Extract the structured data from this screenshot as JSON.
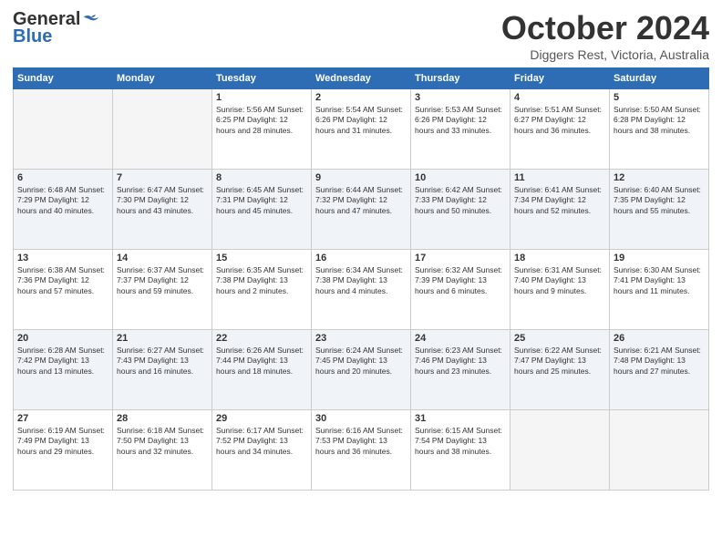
{
  "logo": {
    "general": "General",
    "blue": "Blue"
  },
  "title": "October 2024",
  "subtitle": "Diggers Rest, Victoria, Australia",
  "days_of_week": [
    "Sunday",
    "Monday",
    "Tuesday",
    "Wednesday",
    "Thursday",
    "Friday",
    "Saturday"
  ],
  "weeks": [
    [
      {
        "day": "",
        "info": ""
      },
      {
        "day": "",
        "info": ""
      },
      {
        "day": "1",
        "info": "Sunrise: 5:56 AM\nSunset: 6:25 PM\nDaylight: 12 hours and 28 minutes."
      },
      {
        "day": "2",
        "info": "Sunrise: 5:54 AM\nSunset: 6:26 PM\nDaylight: 12 hours and 31 minutes."
      },
      {
        "day": "3",
        "info": "Sunrise: 5:53 AM\nSunset: 6:26 PM\nDaylight: 12 hours and 33 minutes."
      },
      {
        "day": "4",
        "info": "Sunrise: 5:51 AM\nSunset: 6:27 PM\nDaylight: 12 hours and 36 minutes."
      },
      {
        "day": "5",
        "info": "Sunrise: 5:50 AM\nSunset: 6:28 PM\nDaylight: 12 hours and 38 minutes."
      }
    ],
    [
      {
        "day": "6",
        "info": "Sunrise: 6:48 AM\nSunset: 7:29 PM\nDaylight: 12 hours and 40 minutes."
      },
      {
        "day": "7",
        "info": "Sunrise: 6:47 AM\nSunset: 7:30 PM\nDaylight: 12 hours and 43 minutes."
      },
      {
        "day": "8",
        "info": "Sunrise: 6:45 AM\nSunset: 7:31 PM\nDaylight: 12 hours and 45 minutes."
      },
      {
        "day": "9",
        "info": "Sunrise: 6:44 AM\nSunset: 7:32 PM\nDaylight: 12 hours and 47 minutes."
      },
      {
        "day": "10",
        "info": "Sunrise: 6:42 AM\nSunset: 7:33 PM\nDaylight: 12 hours and 50 minutes."
      },
      {
        "day": "11",
        "info": "Sunrise: 6:41 AM\nSunset: 7:34 PM\nDaylight: 12 hours and 52 minutes."
      },
      {
        "day": "12",
        "info": "Sunrise: 6:40 AM\nSunset: 7:35 PM\nDaylight: 12 hours and 55 minutes."
      }
    ],
    [
      {
        "day": "13",
        "info": "Sunrise: 6:38 AM\nSunset: 7:36 PM\nDaylight: 12 hours and 57 minutes."
      },
      {
        "day": "14",
        "info": "Sunrise: 6:37 AM\nSunset: 7:37 PM\nDaylight: 12 hours and 59 minutes."
      },
      {
        "day": "15",
        "info": "Sunrise: 6:35 AM\nSunset: 7:38 PM\nDaylight: 13 hours and 2 minutes."
      },
      {
        "day": "16",
        "info": "Sunrise: 6:34 AM\nSunset: 7:38 PM\nDaylight: 13 hours and 4 minutes."
      },
      {
        "day": "17",
        "info": "Sunrise: 6:32 AM\nSunset: 7:39 PM\nDaylight: 13 hours and 6 minutes."
      },
      {
        "day": "18",
        "info": "Sunrise: 6:31 AM\nSunset: 7:40 PM\nDaylight: 13 hours and 9 minutes."
      },
      {
        "day": "19",
        "info": "Sunrise: 6:30 AM\nSunset: 7:41 PM\nDaylight: 13 hours and 11 minutes."
      }
    ],
    [
      {
        "day": "20",
        "info": "Sunrise: 6:28 AM\nSunset: 7:42 PM\nDaylight: 13 hours and 13 minutes."
      },
      {
        "day": "21",
        "info": "Sunrise: 6:27 AM\nSunset: 7:43 PM\nDaylight: 13 hours and 16 minutes."
      },
      {
        "day": "22",
        "info": "Sunrise: 6:26 AM\nSunset: 7:44 PM\nDaylight: 13 hours and 18 minutes."
      },
      {
        "day": "23",
        "info": "Sunrise: 6:24 AM\nSunset: 7:45 PM\nDaylight: 13 hours and 20 minutes."
      },
      {
        "day": "24",
        "info": "Sunrise: 6:23 AM\nSunset: 7:46 PM\nDaylight: 13 hours and 23 minutes."
      },
      {
        "day": "25",
        "info": "Sunrise: 6:22 AM\nSunset: 7:47 PM\nDaylight: 13 hours and 25 minutes."
      },
      {
        "day": "26",
        "info": "Sunrise: 6:21 AM\nSunset: 7:48 PM\nDaylight: 13 hours and 27 minutes."
      }
    ],
    [
      {
        "day": "27",
        "info": "Sunrise: 6:19 AM\nSunset: 7:49 PM\nDaylight: 13 hours and 29 minutes."
      },
      {
        "day": "28",
        "info": "Sunrise: 6:18 AM\nSunset: 7:50 PM\nDaylight: 13 hours and 32 minutes."
      },
      {
        "day": "29",
        "info": "Sunrise: 6:17 AM\nSunset: 7:52 PM\nDaylight: 13 hours and 34 minutes."
      },
      {
        "day": "30",
        "info": "Sunrise: 6:16 AM\nSunset: 7:53 PM\nDaylight: 13 hours and 36 minutes."
      },
      {
        "day": "31",
        "info": "Sunrise: 6:15 AM\nSunset: 7:54 PM\nDaylight: 13 hours and 38 minutes."
      },
      {
        "day": "",
        "info": ""
      },
      {
        "day": "",
        "info": ""
      }
    ]
  ]
}
